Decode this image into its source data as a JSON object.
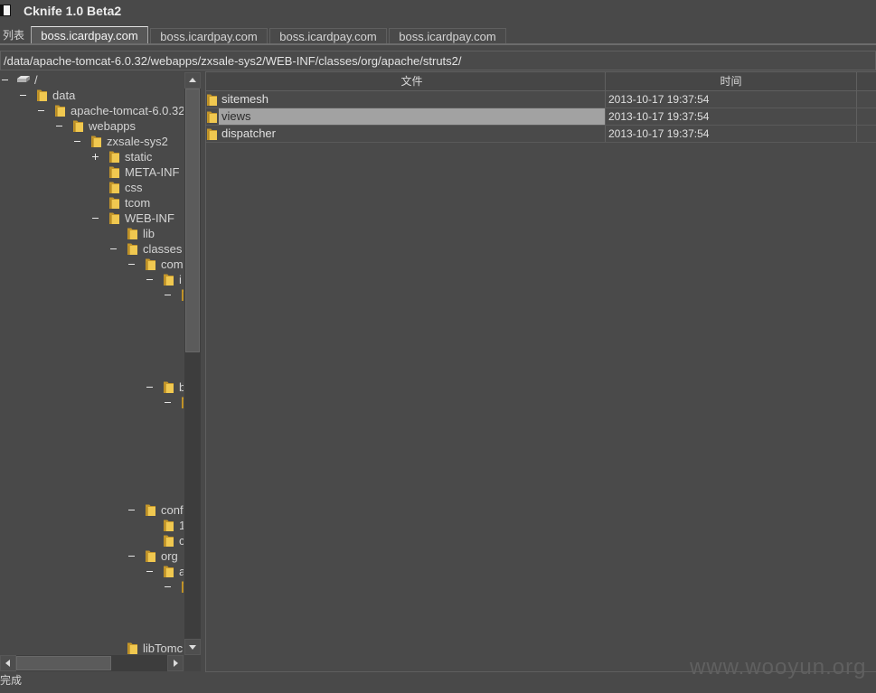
{
  "window": {
    "title": "Cknife 1.0 Beta2"
  },
  "tabs": {
    "list_label": "列表",
    "items": [
      {
        "label": "boss.icardpay.com",
        "selected": true
      },
      {
        "label": "boss.icardpay.com",
        "selected": false
      },
      {
        "label": "boss.icardpay.com",
        "selected": false
      },
      {
        "label": "boss.icardpay.com",
        "selected": false
      }
    ]
  },
  "path": {
    "value": "/data/apache-tomcat-6.0.32/webapps/zxsale-sys2/WEB-INF/classes/org/apache/struts2/"
  },
  "tree": {
    "nodes": [
      {
        "label": "/",
        "level": 0,
        "kind": "drive",
        "toggle": "expanded"
      },
      {
        "label": "data",
        "level": 1,
        "kind": "folder",
        "toggle": "expanded"
      },
      {
        "label": "apache-tomcat-6.0.32",
        "level": 2,
        "kind": "folder",
        "toggle": "expanded"
      },
      {
        "label": "webapps",
        "level": 3,
        "kind": "folder",
        "toggle": "expanded"
      },
      {
        "label": "zxsale-sys2",
        "level": 4,
        "kind": "folder",
        "toggle": "expanded"
      },
      {
        "label": "static",
        "level": 5,
        "kind": "folder",
        "toggle": "collapsed"
      },
      {
        "label": "META-INF",
        "level": 5,
        "kind": "folder"
      },
      {
        "label": "css",
        "level": 5,
        "kind": "folder"
      },
      {
        "label": "tcom",
        "level": 5,
        "kind": "folder"
      },
      {
        "label": "WEB-INF",
        "level": 5,
        "kind": "folder",
        "toggle": "expanded"
      },
      {
        "label": "lib",
        "level": 6,
        "kind": "folder"
      },
      {
        "label": "classes",
        "level": 6,
        "kind": "folder",
        "toggle": "expanded"
      },
      {
        "label": "com",
        "level": 7,
        "kind": "folder",
        "toggle": "expanded"
      },
      {
        "label": "i",
        "level": 8,
        "kind": "folder",
        "toggle": "expanded"
      },
      {
        "label": "",
        "level": 9,
        "kind": "folder",
        "toggle": "expanded"
      },
      {
        "label": "",
        "level": 10
      },
      {
        "label": "",
        "level": 10
      },
      {
        "label": "",
        "level": 10
      },
      {
        "label": "",
        "level": 10
      },
      {
        "label": "",
        "level": 10
      },
      {
        "label": "b",
        "level": 8,
        "kind": "folder",
        "toggle": "expanded"
      },
      {
        "label": "",
        "level": 9,
        "kind": "folder",
        "toggle": "expanded"
      },
      {
        "label": "",
        "level": 10
      },
      {
        "label": "",
        "level": 10
      },
      {
        "label": "",
        "level": 10
      },
      {
        "label": "",
        "level": 10
      },
      {
        "label": "",
        "level": 10
      },
      {
        "label": "",
        "level": 10
      },
      {
        "label": "conf",
        "level": 7,
        "kind": "folder",
        "toggle": "expanded"
      },
      {
        "label": "1",
        "level": 8,
        "kind": "folder"
      },
      {
        "label": "c",
        "level": 8,
        "kind": "folder"
      },
      {
        "label": "org",
        "level": 7,
        "kind": "folder",
        "toggle": "expanded"
      },
      {
        "label": "a",
        "level": 8,
        "kind": "folder",
        "toggle": "expanded"
      },
      {
        "label": "",
        "level": 9,
        "kind": "folder",
        "toggle": "expanded"
      },
      {
        "label": "",
        "level": 10
      },
      {
        "label": "",
        "level": 10
      },
      {
        "label": "",
        "level": 10
      },
      {
        "label": "libTomc",
        "level": 6,
        "kind": "folder"
      }
    ]
  },
  "table": {
    "columns": [
      "文件",
      "时间"
    ],
    "rows": [
      {
        "icon": "folder",
        "name": "sitemesh",
        "time": "2013-10-17 19:37:54",
        "selected": false
      },
      {
        "icon": "folder",
        "name": "views",
        "time": "2013-10-17 19:37:54",
        "selected": true
      },
      {
        "icon": "folder",
        "name": "dispatcher",
        "time": "2013-10-17 19:37:54",
        "selected": false
      }
    ]
  },
  "status": {
    "text": "完成"
  },
  "watermark": {
    "text": "www.wooyun.org"
  },
  "colors": {
    "background": "#494949",
    "panel": "#4a4a4a",
    "text": "#d4d4d4",
    "border": "#5f5f5f",
    "folder": "#f0c850",
    "selection": "#a2a2a2",
    "selection_text": "#2b2b2b",
    "watermark": "#606060"
  }
}
